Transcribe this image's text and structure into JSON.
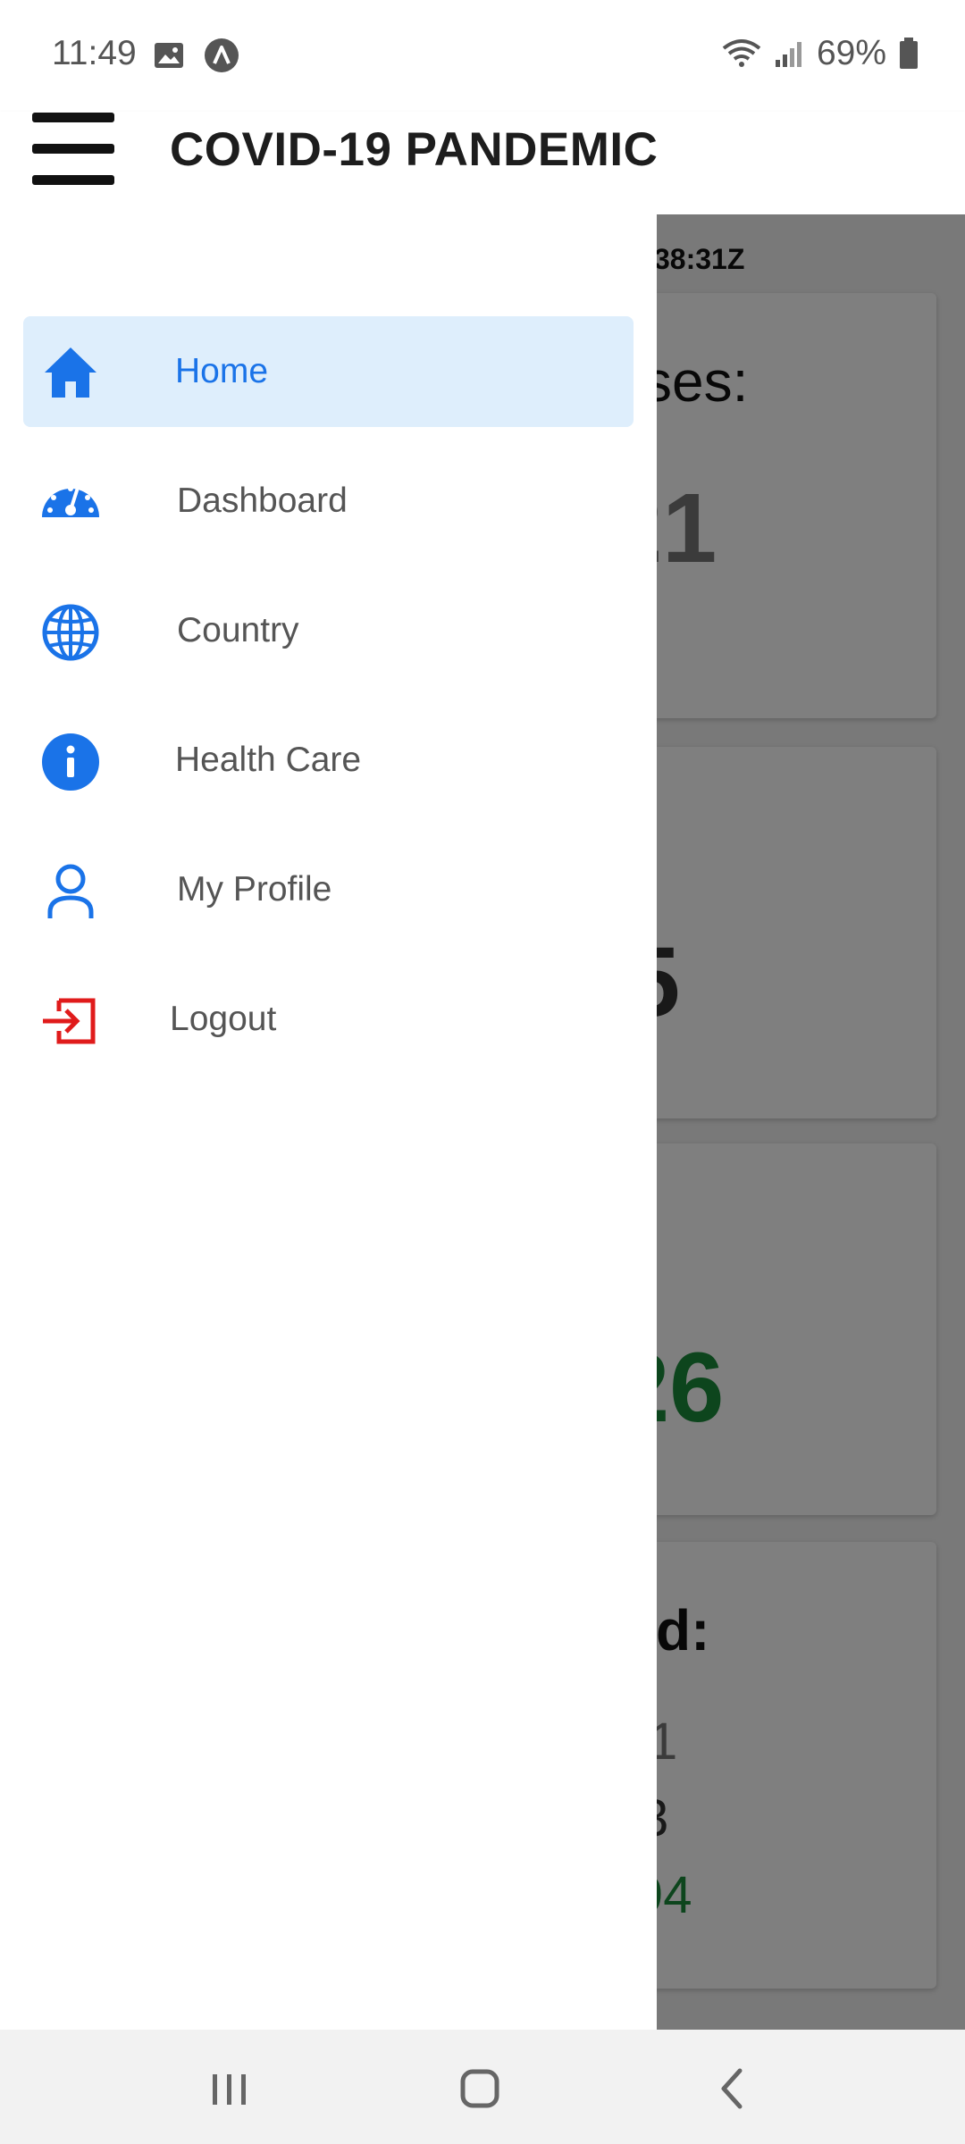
{
  "status_bar": {
    "time": "11:49",
    "battery": "69%",
    "icons": [
      "image-icon",
      "app-a-icon",
      "wifi-icon",
      "signal-icon",
      "battery-icon"
    ]
  },
  "app_bar": {
    "title": "COVID-19 PANDEMIC",
    "menu_icon": "hamburger-menu-icon"
  },
  "drawer": {
    "items": [
      {
        "label": "Home",
        "icon": "home-icon",
        "active": true
      },
      {
        "label": "Dashboard",
        "icon": "speedometer-icon",
        "active": false
      },
      {
        "label": "Country",
        "icon": "globe-icon",
        "active": false
      },
      {
        "label": "Health Care",
        "icon": "info-icon",
        "active": false
      },
      {
        "label": "My Profile",
        "icon": "person-icon",
        "active": false
      },
      {
        "label": "Logout",
        "icon": "logout-icon",
        "active": false
      }
    ]
  },
  "background": {
    "timestamp": "38:31Z",
    "card1_title": "ses:",
    "card1_value": "21",
    "card2_value": "5",
    "card3_value": "26",
    "card4_title": "d:",
    "card4_line1": "1",
    "card4_line2": "3",
    "card4_line3": "94"
  },
  "colors": {
    "accent": "#1a73e8",
    "active_bg": "#deeefc",
    "logout_red": "#e01b1b",
    "green": "#1a8a3a"
  },
  "nav_bar": {
    "icons": [
      "recent-apps-icon",
      "home-button-icon",
      "back-icon"
    ]
  }
}
